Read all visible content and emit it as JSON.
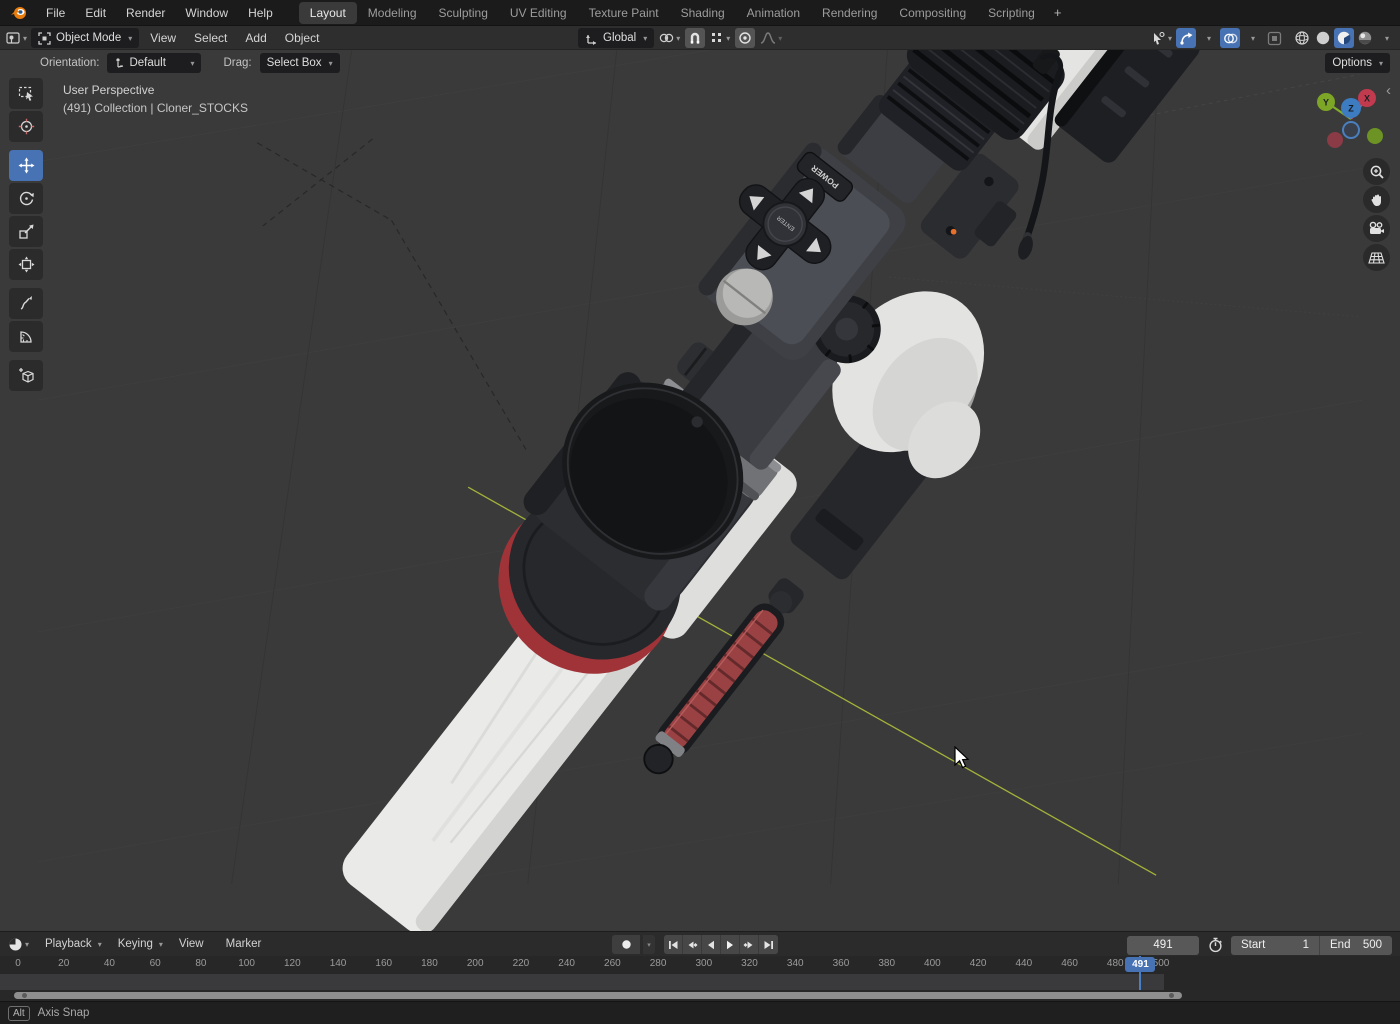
{
  "topbar": {
    "menus": [
      "File",
      "Edit",
      "Render",
      "Window",
      "Help"
    ],
    "tabs": [
      {
        "label": "Layout",
        "active": true
      },
      {
        "label": "Modeling",
        "active": false
      },
      {
        "label": "Sculpting",
        "active": false
      },
      {
        "label": "UV Editing",
        "active": false
      },
      {
        "label": "Texture Paint",
        "active": false
      },
      {
        "label": "Shading",
        "active": false
      },
      {
        "label": "Animation",
        "active": false
      },
      {
        "label": "Rendering",
        "active": false
      },
      {
        "label": "Compositing",
        "active": false
      },
      {
        "label": "Scripting",
        "active": false
      }
    ],
    "new_tab": "+"
  },
  "viewport_header": {
    "mode": "Object Mode",
    "menus": [
      "View",
      "Select",
      "Add",
      "Object"
    ],
    "orientation_value": "Global",
    "shading_modes": [
      "wireframe",
      "solid",
      "material-preview",
      "rendered"
    ]
  },
  "tool_settings": {
    "orientation_label": "Orientation:",
    "orientation_value": "Default",
    "drag_label": "Drag:",
    "drag_value": "Select Box",
    "options_label": "Options"
  },
  "toolbar": {
    "tools": [
      "select-box",
      "cursor",
      "move",
      "rotate",
      "scale",
      "transform",
      "annotate",
      "measure",
      "add-cube"
    ],
    "active_tool": "move"
  },
  "viewport": {
    "overlay_line1": "User Perspective",
    "overlay_line2": "(491) Collection | Cloner_STOCKS",
    "gizmo_axes": {
      "x": "X",
      "y": "Y",
      "z": "Z"
    },
    "nav_buttons": [
      "zoom",
      "pan",
      "camera-view",
      "toggle-perspective"
    ]
  },
  "model": {
    "power_label": "POWER",
    "enter_label": "ENTER"
  },
  "timeline": {
    "menus": [
      {
        "label": "Playback",
        "chevron": "▾"
      },
      {
        "label": "Keying",
        "chevron": "▾"
      },
      {
        "label": "View",
        "chevron": ""
      },
      {
        "label": "Marker",
        "chevron": ""
      }
    ],
    "current_frame": "491",
    "start_label": "Start",
    "start_value": "1",
    "end_label": "End",
    "end_value": "500",
    "ruler_ticks": [
      0,
      20,
      40,
      60,
      80,
      100,
      120,
      140,
      160,
      180,
      200,
      220,
      240,
      260,
      280,
      300,
      320,
      340,
      360,
      380,
      400,
      420,
      440,
      460,
      480,
      500
    ]
  },
  "statusbar": {
    "key": "Alt",
    "text": "Axis Snap"
  },
  "colors": {
    "accent": "#4772b3",
    "axis_x": "#c23a4e",
    "axis_y": "#7da526",
    "axis_z": "#3d7cc0",
    "yellow_axis_line": "#a4b23a",
    "red_accent": "#a03338"
  }
}
